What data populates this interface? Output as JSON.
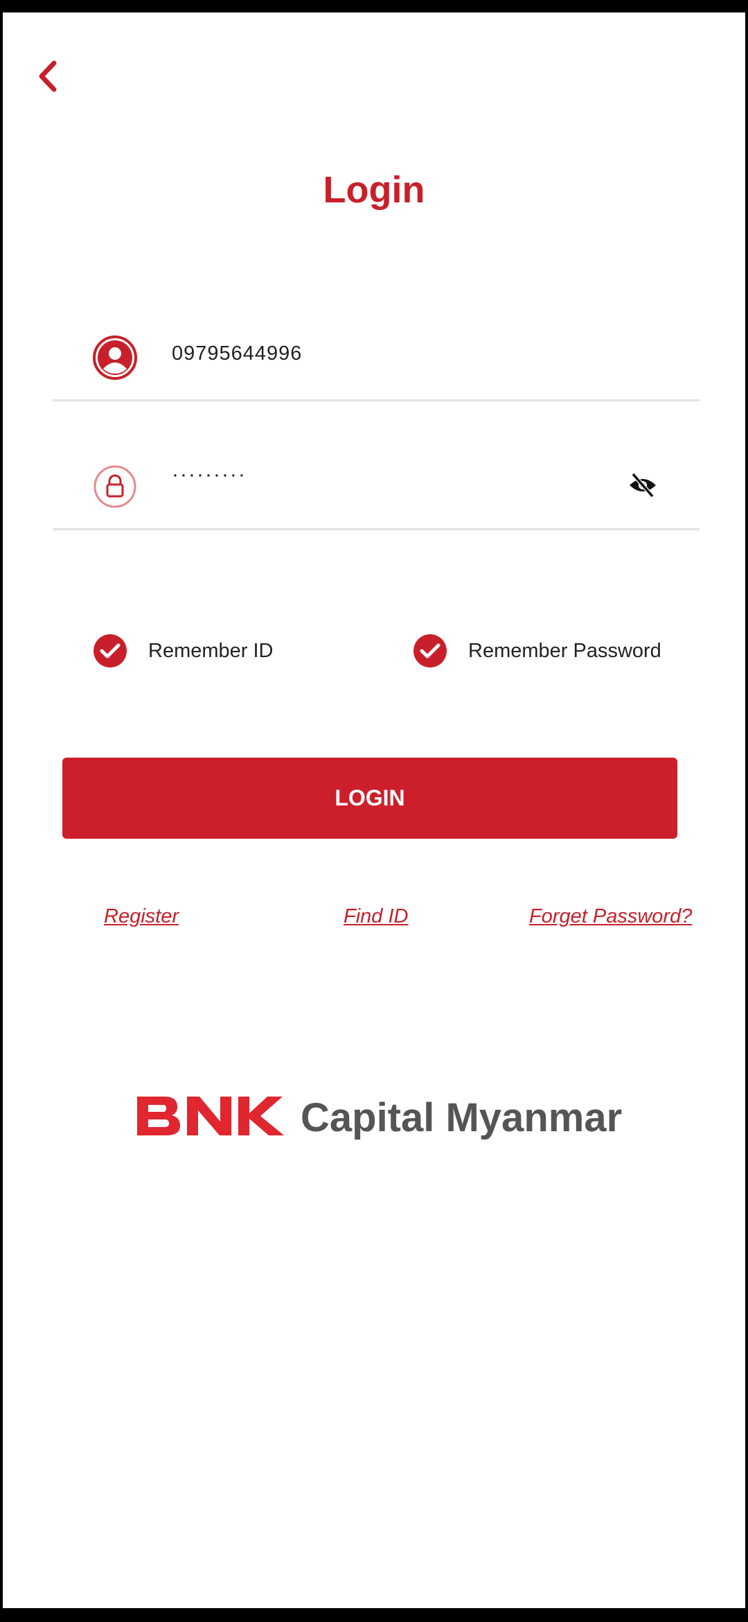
{
  "header": {
    "back_icon": "chevron-left-icon",
    "title": "Login"
  },
  "form": {
    "id_value": "09795644996",
    "id_icon": "user-icon",
    "password_value": "·········",
    "password_icon": "lock-icon",
    "visibility_icon": "eye-off-icon"
  },
  "options": {
    "remember_id": {
      "label": "Remember ID",
      "checked": true
    },
    "remember_password": {
      "label": "Remember Password",
      "checked": true
    }
  },
  "actions": {
    "login_label": "LOGIN"
  },
  "links": {
    "register": "Register",
    "find_id": "Find ID",
    "forget_password": "Forget Password?"
  },
  "logo": {
    "brand": "BNK",
    "text": "Capital Myanmar"
  },
  "colors": {
    "accent": "#c8202a",
    "button": "#cd1f2b",
    "logo_text": "#555555"
  }
}
